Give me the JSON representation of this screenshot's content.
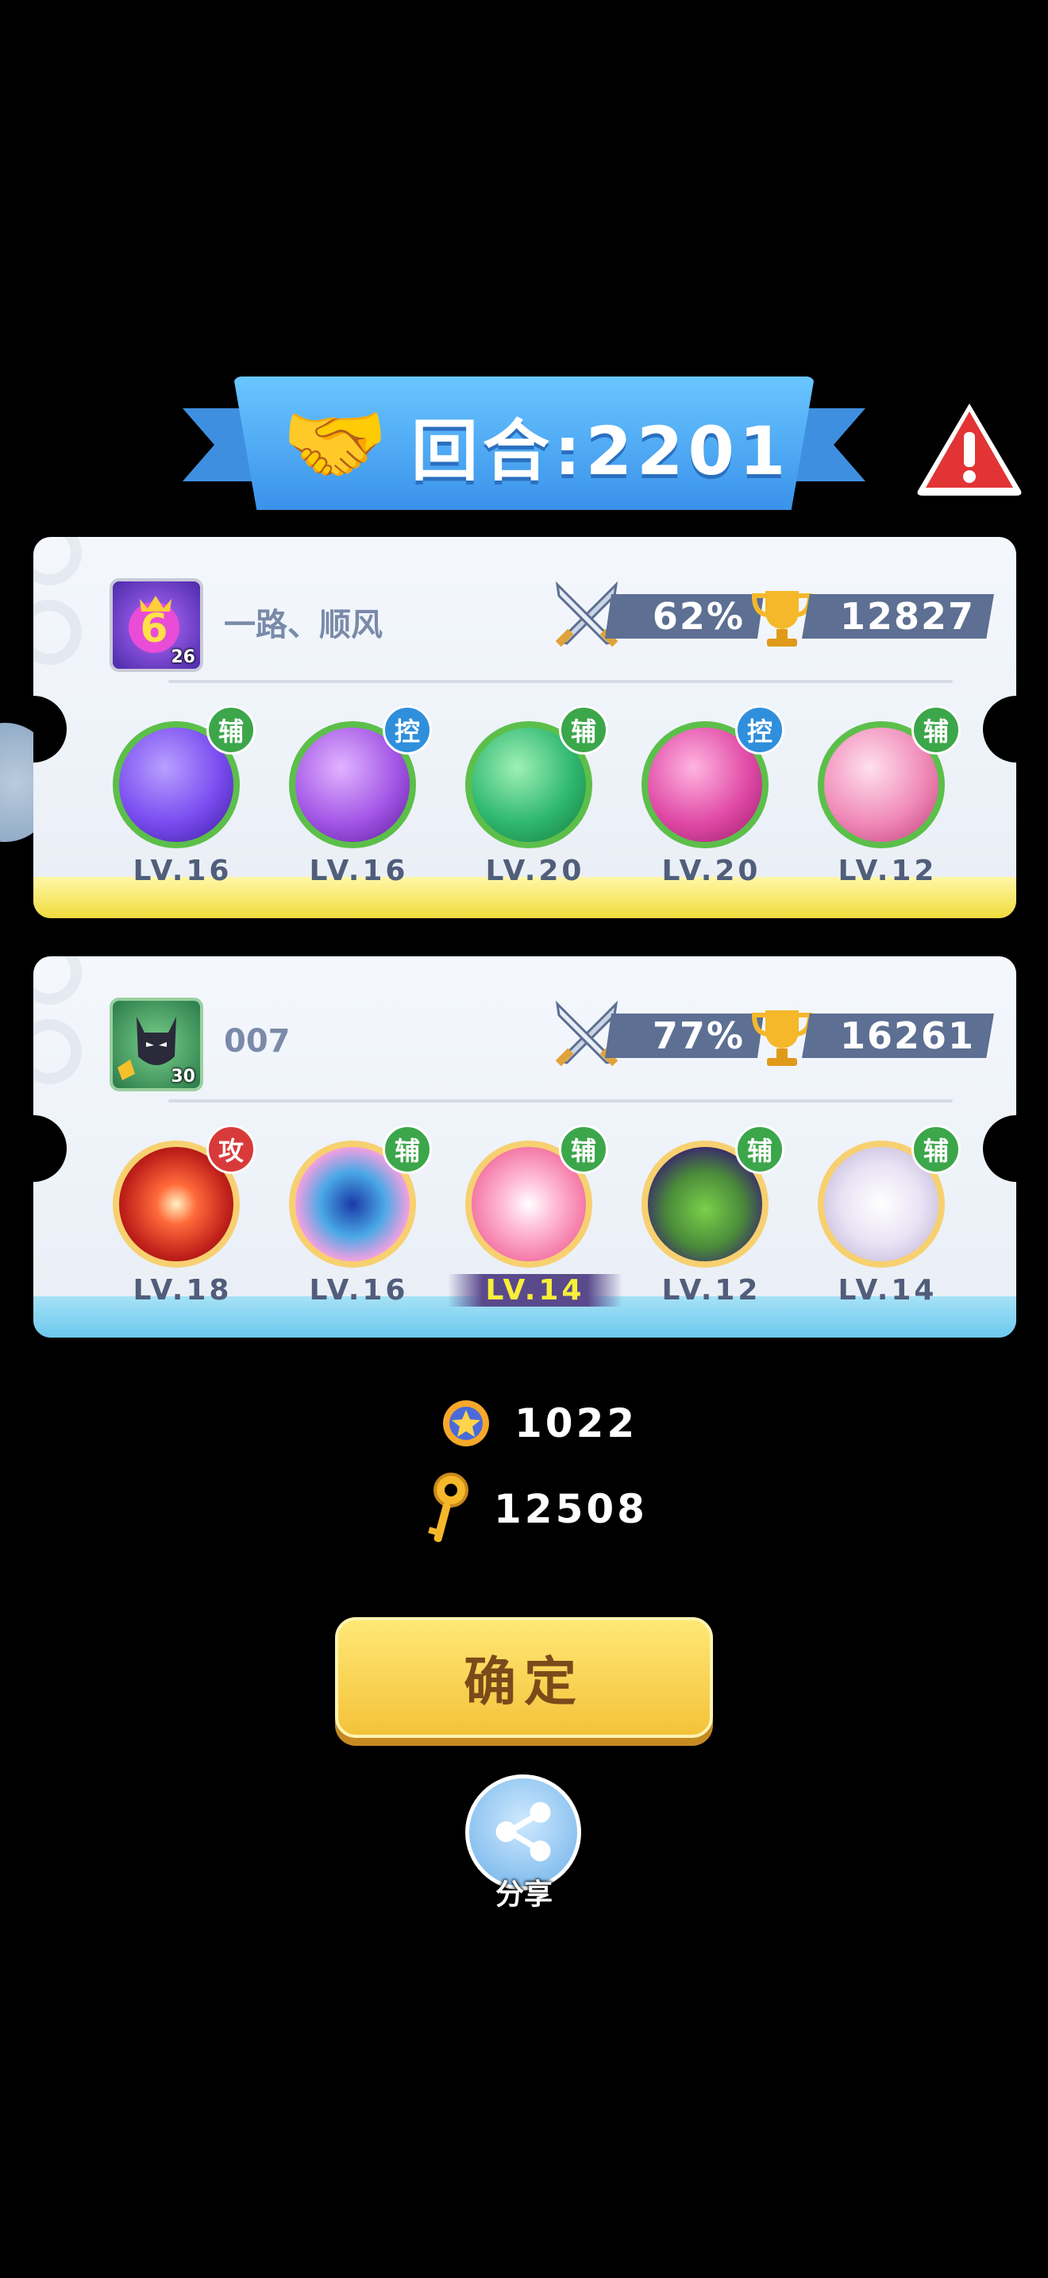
{
  "header": {
    "round_label": "回合:2201"
  },
  "teams": [
    {
      "player_name": "一路、顺风",
      "avatar_level": "26",
      "win_rate": "62%",
      "trophies": "12827",
      "pets": [
        {
          "level": "LV.16",
          "role": "辅",
          "role_type": "support",
          "color": "#7a4cf0",
          "highlight": false
        },
        {
          "level": "LV.16",
          "role": "控",
          "role_type": "control",
          "color": "#a456e6",
          "highlight": false
        },
        {
          "level": "LV.20",
          "role": "辅",
          "role_type": "support",
          "color": "#2fb870",
          "highlight": false
        },
        {
          "level": "LV.20",
          "role": "控",
          "role_type": "control",
          "color": "#e04aa6",
          "highlight": false
        },
        {
          "level": "LV.12",
          "role": "辅",
          "role_type": "support",
          "color": "#f08ab8",
          "highlight": false
        }
      ]
    },
    {
      "player_name": "007",
      "avatar_level": "30",
      "win_rate": "77%",
      "trophies": "16261",
      "pets": [
        {
          "level": "LV.18",
          "role": "攻",
          "role_type": "attack",
          "color": "#e03a2a",
          "highlight": false
        },
        {
          "level": "LV.16",
          "role": "辅",
          "role_type": "support",
          "color": "#4aa8e6",
          "highlight": false
        },
        {
          "level": "LV.14",
          "role": "辅",
          "role_type": "support",
          "color": "#f47aa8",
          "highlight": true
        },
        {
          "level": "LV.12",
          "role": "辅",
          "role_type": "support",
          "color": "#4a8a3a",
          "highlight": false
        },
        {
          "level": "LV.14",
          "role": "辅",
          "role_type": "support",
          "color": "#d9d2e8",
          "highlight": false
        }
      ]
    }
  ],
  "rewards": {
    "coins": "1022",
    "keys": "12508"
  },
  "buttons": {
    "confirm": "确定",
    "share": "分享"
  },
  "icons": [
    "handshake-icon",
    "warning-icon",
    "sword-icon",
    "trophy-icon",
    "coin-icon",
    "key-icon",
    "share-icon"
  ]
}
